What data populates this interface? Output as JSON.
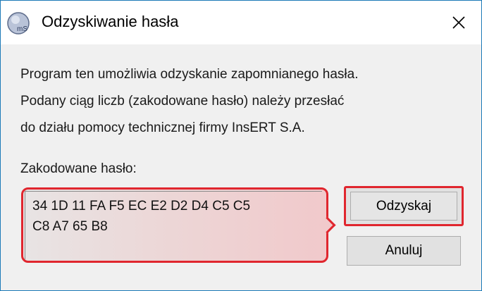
{
  "window": {
    "title": "Odzyskiwanie hasła"
  },
  "description": {
    "lines": [
      "Program ten umożliwia odzyskanie zapomnianego hasła.",
      "Podany ciąg liczb (zakodowane hasło) należy przesłać",
      "do działu pomocy technicznej firmy InsERT S.A."
    ]
  },
  "encoded_password": {
    "label": "Zakodowane hasło:",
    "lines": [
      "34 1D 11 FA F5 EC E2 D2 D4 C5 C5",
      "C8 A7 65 B8"
    ]
  },
  "buttons": {
    "recover": "Odzyskaj",
    "cancel": "Anuluj"
  },
  "icons": {
    "app": "insert-app-icon",
    "close": "close-icon"
  },
  "colors": {
    "highlight": "#e0262e",
    "window_border": "#1c7ab8"
  }
}
